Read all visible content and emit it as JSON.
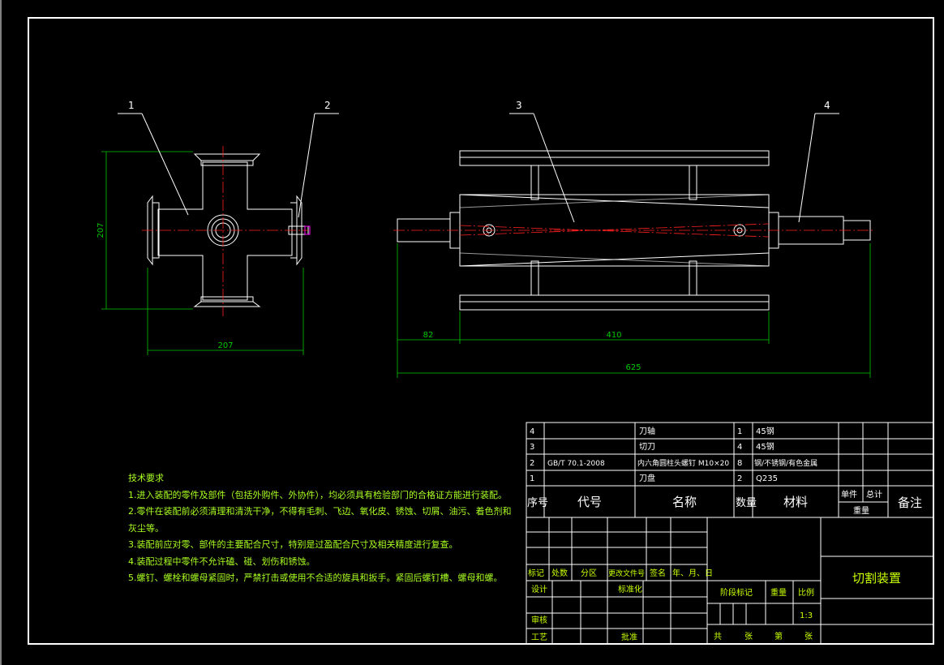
{
  "balloons": [
    "1",
    "2",
    "3",
    "4"
  ],
  "dimensions": {
    "left_height": "207",
    "left_width": "207",
    "shaft_stub": "82",
    "body_length": "410",
    "overall_length": "625"
  },
  "tech_requirements": {
    "title": "技术要求",
    "items": [
      "1.进入装配的零件及部件（包括外购件、外协件），均必须具有检验部门的合格证方能进行装配。",
      "2.零件在装配前必须清理和清洗干净，不得有毛刺、飞边、氧化皮、锈蚀、切屑、油污、着色剂和",
      "灰尘等。",
      "3.装配前应对零、部件的主要配合尺寸，特别是过盈配合尺寸及相关精度进行复查。",
      "4.装配过程中零件不允许磕、碰、划伤和锈蚀。",
      "5.螺钉、螺栓和螺母紧固时，严禁打击或使用不合适的旋具和扳手。紧固后螺钉槽、螺母和螺。"
    ]
  },
  "bom": {
    "rows": [
      {
        "no": "4",
        "code": "",
        "name": "刀轴",
        "qty": "1",
        "material": "45钢"
      },
      {
        "no": "3",
        "code": "",
        "name": "切刀",
        "qty": "4",
        "material": "45钢"
      },
      {
        "no": "2",
        "code": "GB/T 70.1-2008",
        "name": "内六角圆柱头螺钉 M10×20",
        "qty": "8",
        "material": "钢/不锈钢/有色金属"
      },
      {
        "no": "1",
        "code": "",
        "name": "刀盘",
        "qty": "2",
        "material": "Q235"
      }
    ],
    "header": {
      "no": "序号",
      "code": "代号",
      "name": "名称",
      "qty": "数量",
      "material": "材料",
      "single": "单件",
      "total": "总计",
      "weight": "重量",
      "remark": "备注"
    }
  },
  "title_block": {
    "drawing_name": "切割装置",
    "rev_headers": [
      "标记",
      "处数",
      "分区",
      "更改文件号",
      "签名",
      "年、月、日"
    ],
    "design": "设计",
    "standardize": "标准化",
    "check": "审核",
    "process": "工艺",
    "approve": "批准",
    "stage_mark": "阶段标记",
    "weight": "重量",
    "scale": "比例",
    "scale_value": "1:3",
    "sheets_total": "共",
    "sheet_unit": "张",
    "sheet_no": "第",
    "sheet_unit2": "张"
  }
}
